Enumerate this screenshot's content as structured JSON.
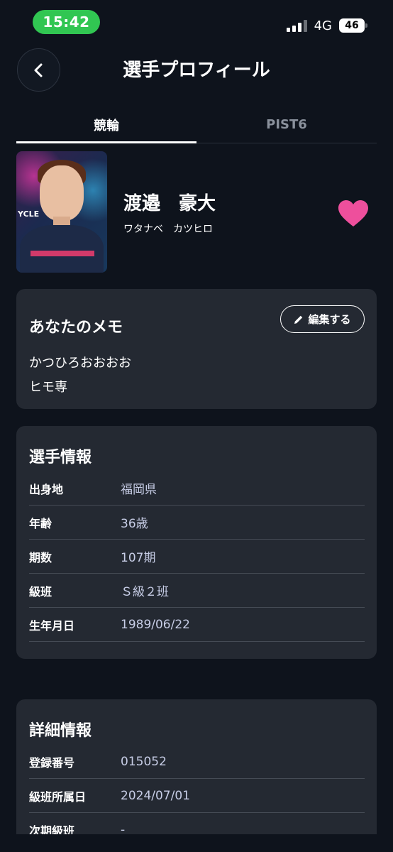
{
  "status_bar": {
    "time": "15:42",
    "network": "4G",
    "battery": "46"
  },
  "header": {
    "title": "選手プロフィール"
  },
  "tabs": [
    {
      "label": "競輪",
      "active": true
    },
    {
      "label": "PIST6",
      "active": false
    }
  ],
  "profile": {
    "name": "渡邉　豪大",
    "kana": "ワタナベ　カツヒロ",
    "photo_text": "YCLE",
    "favorite": true,
    "favorite_color": "#ee4f9c"
  },
  "memo": {
    "title": "あなたのメモ",
    "edit_label": "編集する",
    "lines": [
      "かつひろおおおお",
      "ヒモ専"
    ]
  },
  "player_info": {
    "title": "選手情報",
    "rows": [
      {
        "label": "出身地",
        "value": "福岡県"
      },
      {
        "label": "年齢",
        "value": "36歳"
      },
      {
        "label": "期数",
        "value": "107期"
      },
      {
        "label": "級班",
        "value": "Ｓ級２班"
      },
      {
        "label": "生年月日",
        "value": "1989/06/22"
      }
    ]
  },
  "detail_info": {
    "title": "詳細情報",
    "rows": [
      {
        "label": "登録番号",
        "value": "015052"
      },
      {
        "label": "級班所属日",
        "value": "2024/07/01"
      },
      {
        "label": "次期級班",
        "value": "-"
      }
    ]
  },
  "colors": {
    "background": "#0e131c",
    "card": "#242932",
    "value_text": "#c7cde6",
    "status_green": "#31c652"
  },
  "icons": {
    "back": "chevron-left-icon",
    "edit": "pencil-icon",
    "favorite": "heart-icon"
  }
}
